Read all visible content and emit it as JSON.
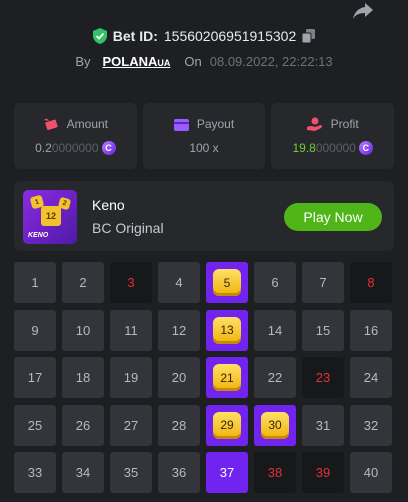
{
  "header": {
    "share_icon": "share-arrow-icon",
    "bet_id_label": "Bet ID:",
    "bet_id": "15560206951915302",
    "copy_icon": "copy-icon",
    "shield_icon": "shield-check-icon",
    "by_label": "By",
    "username": "POLANA",
    "username_suffix": "UA",
    "on_label": "On",
    "date": "08.09.2022, 22:22:13"
  },
  "stats": {
    "amount": {
      "icon": "money-wings-icon",
      "label": "Amount",
      "value_main": "0.2",
      "value_dim": "0000000"
    },
    "payout": {
      "icon": "wallet-icon",
      "label": "Payout",
      "value": "100 x"
    },
    "profit": {
      "icon": "hand-coin-icon",
      "label": "Profit",
      "value_main": "19.8",
      "value_dim": "000000"
    },
    "coin_symbol": "C"
  },
  "game": {
    "thumb_label": "KENO",
    "thumb_numbers": [
      "1",
      "12",
      "2"
    ],
    "name": "Keno",
    "provider": "BC Original",
    "play_label": "Play Now"
  },
  "board": {
    "numbers": [
      "1",
      "2",
      "3",
      "4",
      "5",
      "6",
      "7",
      "8",
      "9",
      "10",
      "11",
      "12",
      "13",
      "14",
      "15",
      "16",
      "17",
      "18",
      "19",
      "20",
      "21",
      "22",
      "23",
      "24",
      "25",
      "26",
      "27",
      "28",
      "29",
      "30",
      "31",
      "32",
      "33",
      "34",
      "35",
      "36",
      "37",
      "38",
      "39",
      "40"
    ],
    "hits": [
      "5",
      "13",
      "21",
      "29",
      "30"
    ],
    "selected_miss": [
      "37"
    ],
    "drawn_miss": [
      "3",
      "8",
      "23",
      "38",
      "39"
    ]
  },
  "colors": {
    "accent_purple": "#7124ef",
    "play_green": "#4fb518",
    "drawn_red": "#e0313b",
    "profit_green": "#6fd12c"
  }
}
